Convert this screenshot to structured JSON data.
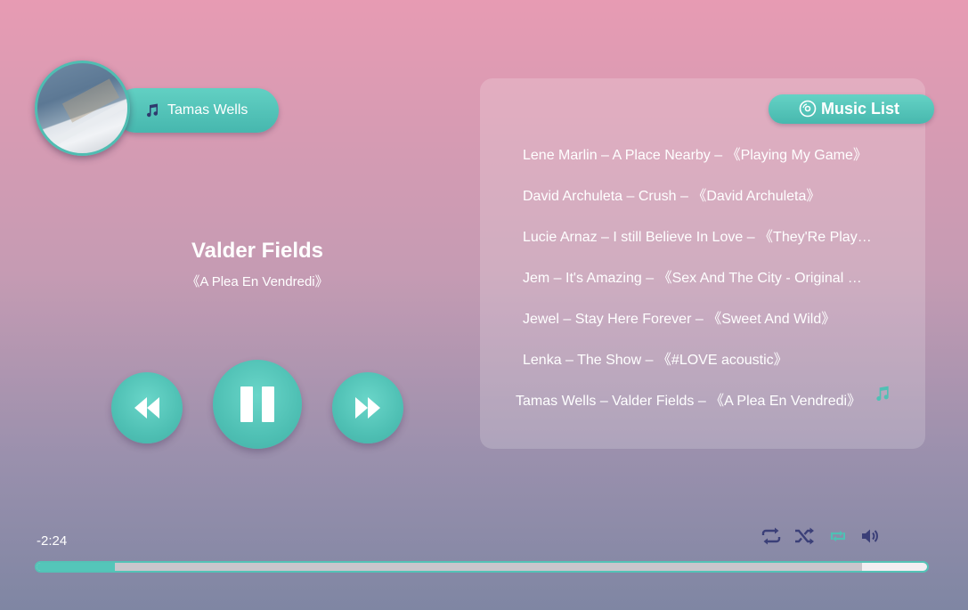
{
  "artist": {
    "name": "Tamas Wells",
    "note_icon": "music-note-icon"
  },
  "now_playing": {
    "title": "Valder Fields",
    "album": "《A Plea En Vendredi》"
  },
  "controls": {
    "prev_icon": "rewind-icon",
    "pause_icon": "pause-icon",
    "next_icon": "fast-forward-icon"
  },
  "playlist": {
    "header": "Music List",
    "header_icon": "disc-icon",
    "tracks": [
      "Lene Marlin – A Place Nearby – 《Playing My Game》",
      "David Archuleta – Crush – 《David Archuleta》",
      "Lucie Arnaz – I still Believe In Love – 《They'Re Playing Our Song》",
      "Jem – It's Amazing – 《Sex And The City - Original Motion Picture Soundtrack》",
      "Jewel – Stay Here Forever – 《Sweet And Wild》",
      "Lenka – The Show – 《#LOVE acoustic》",
      "Tamas Wells – Valder Fields – 《A Plea En Vendredi》"
    ],
    "active_index": 6
  },
  "player": {
    "time_remaining": "-2:24",
    "progress_fraction": 0.088,
    "buffered_fraction": 0.927
  },
  "colors": {
    "accent": "#54c6b9",
    "icon_dark": "#3b3f78",
    "icon_accent": "#4fc0b4"
  }
}
